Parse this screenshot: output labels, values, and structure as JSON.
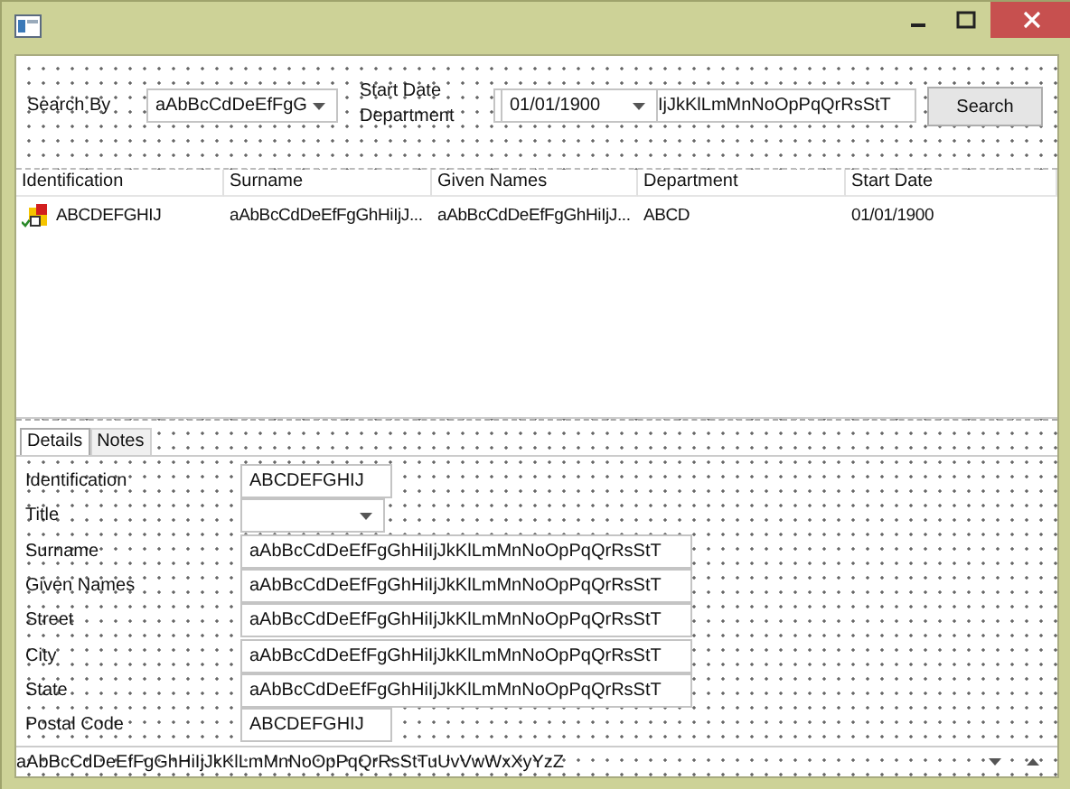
{
  "search": {
    "label": "Search By",
    "field_combo": {
      "value": "aAbBcCdDeEfFgG"
    },
    "overlapping_labels": [
      "Start Date",
      "Department"
    ],
    "date_combo": {
      "value": "01/01/1900"
    },
    "text_field": {
      "value": "IjJkKlLmMnNoOpPqQrRsStT"
    },
    "button": "Search"
  },
  "table": {
    "columns": [
      "Identification",
      "Surname",
      "Given Names",
      "Department",
      "Start Date"
    ],
    "rows": [
      {
        "cells": [
          "ABCDEFGHIJ",
          "aAbBcCdDeEfFgGhHiIjJ...",
          "aAbBcCdDeEfFgGhHiIjJ...",
          "ABCD",
          "01/01/1900"
        ]
      }
    ]
  },
  "tabs": [
    {
      "label": "Details",
      "selected": true
    },
    {
      "label": "Notes",
      "selected": false
    }
  ],
  "details": {
    "fields": [
      {
        "label": "Identification",
        "kind": "short",
        "value": "ABCDEFGHIJ"
      },
      {
        "label": "Title",
        "kind": "combo"
      },
      {
        "label": "Surname",
        "kind": "long",
        "value": "aAbBcCdDeEfFgGhHiIjJkKlLmMnNoOpPqQrRsStT"
      },
      {
        "label": "Given Names",
        "kind": "long",
        "value": "aAbBcCdDeEfFgGhHiIjJkKlLmMnNoOpPqQrRsStT"
      },
      {
        "label": "Street",
        "kind": "long",
        "value": "aAbBcCdDeEfFgGhHiIjJkKlLmMnNoOpPqQrRsStT"
      },
      {
        "label": "City",
        "kind": "long",
        "value": "aAbBcCdDeEfFgGhHiIjJkKlLmMnNoOpPqQrRsStT"
      },
      {
        "label": "State",
        "kind": "long",
        "value": "aAbBcCdDeEfFgGhHiIjJkKlLmMnNoOpPqQrRsStT"
      },
      {
        "label": "Postal Code",
        "kind": "short",
        "value": "ABCDEFGHIJ"
      }
    ]
  },
  "status": {
    "text": "aAbBcCdDeEfFgGhHiIjJkKlLmMnNoOpPqQrRsStTuUvVwWxXyYzZ"
  }
}
